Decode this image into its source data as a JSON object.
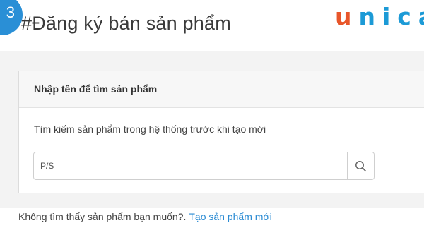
{
  "header": {
    "step_number": "3",
    "title": "#Đăng ký bán sản phẩm"
  },
  "brand": {
    "logo_first": "u",
    "logo_rest": "nica",
    "logo_colors": {
      "u": "#e8562a",
      "rest": "#1c9ad6"
    }
  },
  "search_panel": {
    "header": "Nhập tên để tìm sản phẩm",
    "hint": "Tìm kiếm sản phẩm trong hệ thống trước khi tạo mới",
    "input_value": "P/S",
    "button_icon": "search-icon"
  },
  "footer": {
    "not_found_text": "Không tìm thấy sản phẩm bạn muốn?.",
    "create_link": "Tạo sản phẩm mới",
    "link_color": "#2b8bd3"
  },
  "colors": {
    "accent": "#2a8fd6"
  }
}
